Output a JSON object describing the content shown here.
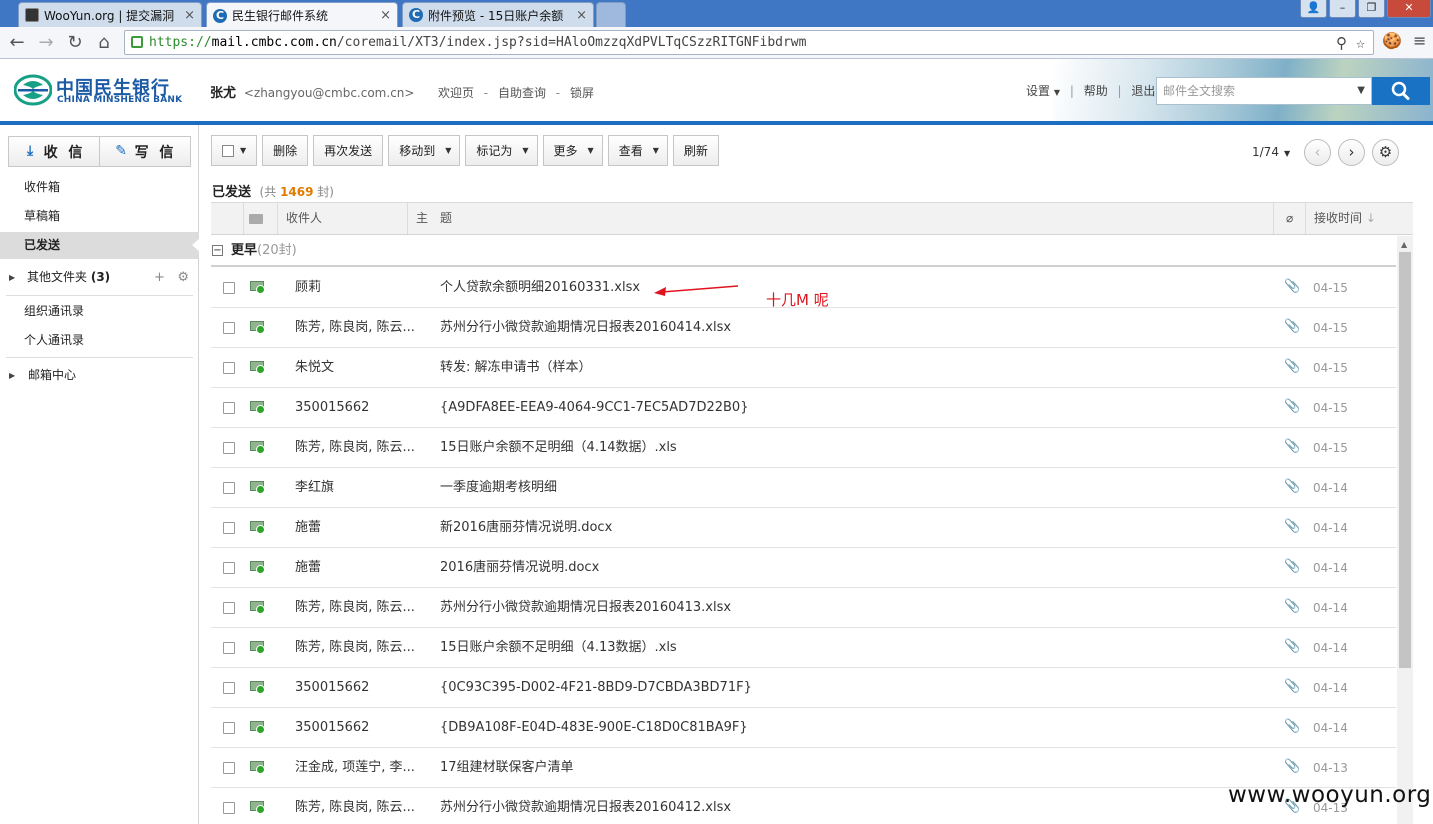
{
  "browser": {
    "tabs": [
      {
        "title": "WooYun.org | 提交漏洞"
      },
      {
        "title": "民生银行邮件系统",
        "active": true
      },
      {
        "title": "附件预览 - 15日账户余额"
      }
    ],
    "url": {
      "scheme": "https://",
      "host": "mail.cmbc.com.cn",
      "path": "/coremail/XT3/index.jsp?sid=HAloOmzzqXdPVLTqCSzzRITGNFibdrwm"
    }
  },
  "header": {
    "logo_cn": "中国民生银行",
    "logo_en": "CHINA MINSHENG BANK",
    "user_name": "张尤",
    "user_email": "<zhangyou@cmbc.com.cn>",
    "links": [
      "欢迎页",
      "自助查询",
      "锁屏"
    ],
    "settings": "设置",
    "help": "帮助",
    "logout": "退出",
    "search_placeholder": "邮件全文搜索",
    "accent_color": "#1b6ec2"
  },
  "sidebar": {
    "receive": "收 信",
    "compose": "写 信",
    "folders": [
      {
        "label": "收件箱"
      },
      {
        "label": "草稿箱"
      },
      {
        "label": "已发送",
        "active": true
      }
    ],
    "other_folders": "其他文件夹",
    "other_count": "(3)",
    "contacts": [
      "组织通讯录",
      "个人通讯录"
    ],
    "mail_center": "邮箱中心"
  },
  "actions": {
    "delete": "删除",
    "resend": "再次发送",
    "move_to": "移动到",
    "mark_as": "标记为",
    "more": "更多",
    "view": "查看",
    "refresh": "刷新"
  },
  "pager": {
    "page": "1/74"
  },
  "list": {
    "folder_name": "已发送",
    "total_prefix": "(共",
    "total": "1469",
    "total_suffix": "封)",
    "columns": {
      "recipient": "收件人",
      "subject": "主　题",
      "time": "接收时间"
    },
    "group": {
      "label": "更早",
      "count": "(20封)"
    },
    "rows": [
      {
        "from": "顾莉",
        "subject": "个人贷款余额明细20160331.xlsx",
        "date": "04-15"
      },
      {
        "from": "陈芳, 陈良岗, 陈云...",
        "subject": "苏州分行小微贷款逾期情况日报表20160414.xlsx",
        "date": "04-15"
      },
      {
        "from": "朱悦文",
        "subject": "转发: 解冻申请书（样本）",
        "date": "04-15"
      },
      {
        "from": "350015662",
        "subject": "{A9DFA8EE-EEA9-4064-9CC1-7EC5AD7D22B0}",
        "date": "04-15"
      },
      {
        "from": "陈芳, 陈良岗, 陈云...",
        "subject": "15日账户余额不足明细（4.14数据）.xls",
        "date": "04-15"
      },
      {
        "from": "李红旗",
        "subject": "一季度逾期考核明细",
        "date": "04-14"
      },
      {
        "from": "施蕾",
        "subject": "新2016唐丽芬情况说明.docx",
        "date": "04-14"
      },
      {
        "from": "施蕾",
        "subject": "2016唐丽芬情况说明.docx",
        "date": "04-14"
      },
      {
        "from": "陈芳, 陈良岗, 陈云...",
        "subject": "苏州分行小微贷款逾期情况日报表20160413.xlsx",
        "date": "04-14"
      },
      {
        "from": "陈芳, 陈良岗, 陈云...",
        "subject": "15日账户余额不足明细（4.13数据）.xls",
        "date": "04-14"
      },
      {
        "from": "350015662",
        "subject": "{0C93C395-D002-4F21-8BD9-D7CBDA3BD71F}",
        "date": "04-14"
      },
      {
        "from": "350015662",
        "subject": "{DB9A108F-E04D-483E-900E-C18D0C81BA9F}",
        "date": "04-14"
      },
      {
        "from": "汪金成, 项莲宁, 李...",
        "subject": "17组建材联保客户清单",
        "date": "04-13"
      },
      {
        "from": "陈芳, 陈良岗, 陈云...",
        "subject": "苏州分行小微贷款逾期情况日报表20160412.xlsx",
        "date": "04-13"
      }
    ]
  },
  "annotation": {
    "text": "十几M 呢",
    "color": "#e0141e"
  },
  "watermark": "www.wooyun.org"
}
